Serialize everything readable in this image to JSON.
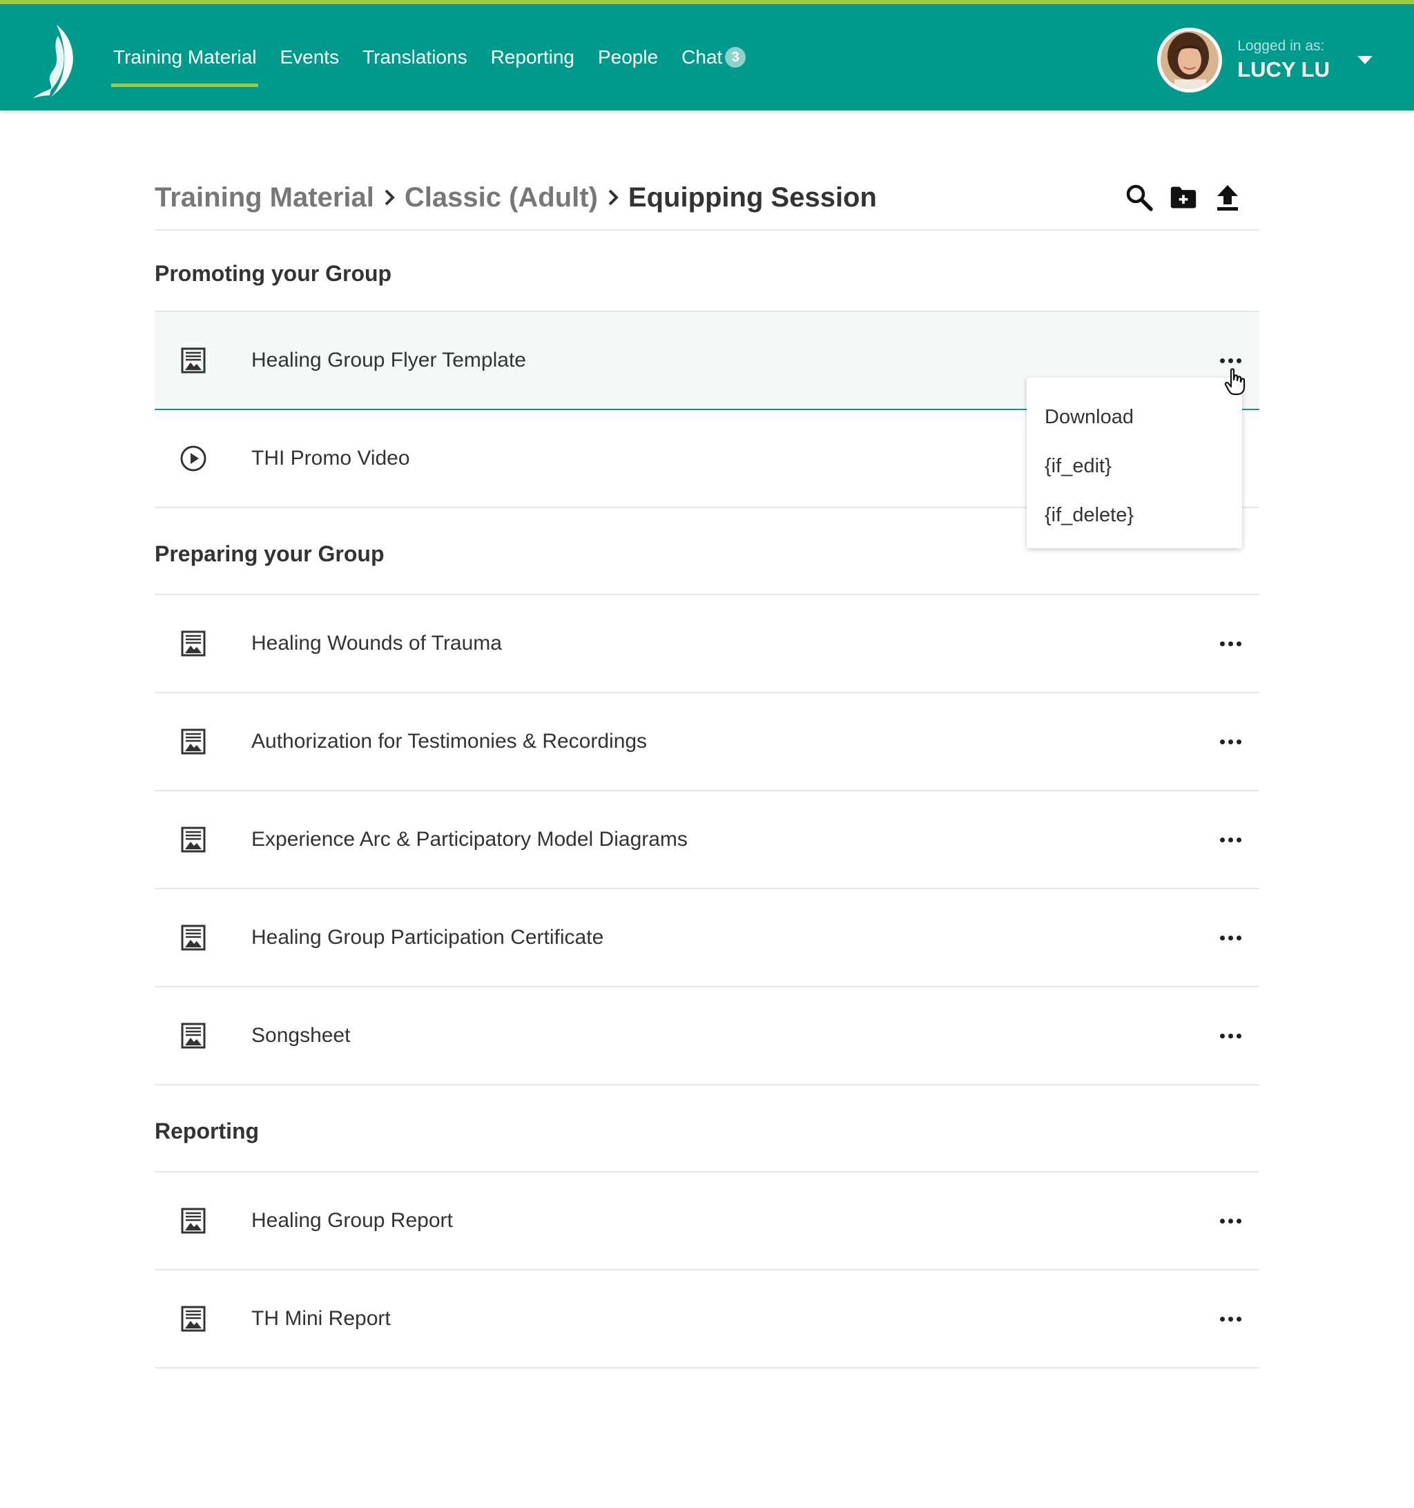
{
  "nav": {
    "items": [
      {
        "label": "Training Material",
        "active": true
      },
      {
        "label": "Events",
        "active": false
      },
      {
        "label": "Translations",
        "active": false
      },
      {
        "label": "Reporting",
        "active": false
      },
      {
        "label": "People",
        "active": false
      },
      {
        "label": "Chat",
        "active": false
      }
    ],
    "chat_badge": "3"
  },
  "user": {
    "logged_label": "Logged in as:",
    "name": "LUCY LU"
  },
  "breadcrumb": [
    "Training Material",
    "Classic (Adult)",
    "Equipping Session"
  ],
  "toolbar": {
    "icons": [
      "search-icon",
      "new-folder-icon",
      "upload-icon"
    ]
  },
  "sections": [
    {
      "title": "Promoting your Group",
      "items": [
        {
          "label": "Healing Group Flyer Template",
          "icon": "document-image-icon"
        },
        {
          "label": "THI Promo Video",
          "icon": "play-circle-icon"
        }
      ]
    },
    {
      "title": "Preparing your Group",
      "items": [
        {
          "label": "Healing Wounds of Trauma",
          "icon": "document-image-icon"
        },
        {
          "label": "Authorization for Testimonies & Recordings",
          "icon": "document-image-icon"
        },
        {
          "label": "Experience Arc & Participatory Model Diagrams",
          "icon": "document-image-icon"
        },
        {
          "label": "Healing Group Participation Certificate",
          "icon": "document-image-icon"
        },
        {
          "label": "Songsheet",
          "icon": "document-image-icon"
        }
      ]
    },
    {
      "title": "Reporting",
      "items": [
        {
          "label": "Healing Group Report",
          "icon": "document-image-icon"
        },
        {
          "label": "TH Mini Report",
          "icon": "document-image-icon"
        }
      ]
    }
  ],
  "dropdown": {
    "items": [
      "Download",
      "{if_edit}",
      "{if_delete}"
    ]
  },
  "colors": {
    "header": "#009a8c",
    "accent": "#a3c83a",
    "hover_border": "#14948a"
  }
}
